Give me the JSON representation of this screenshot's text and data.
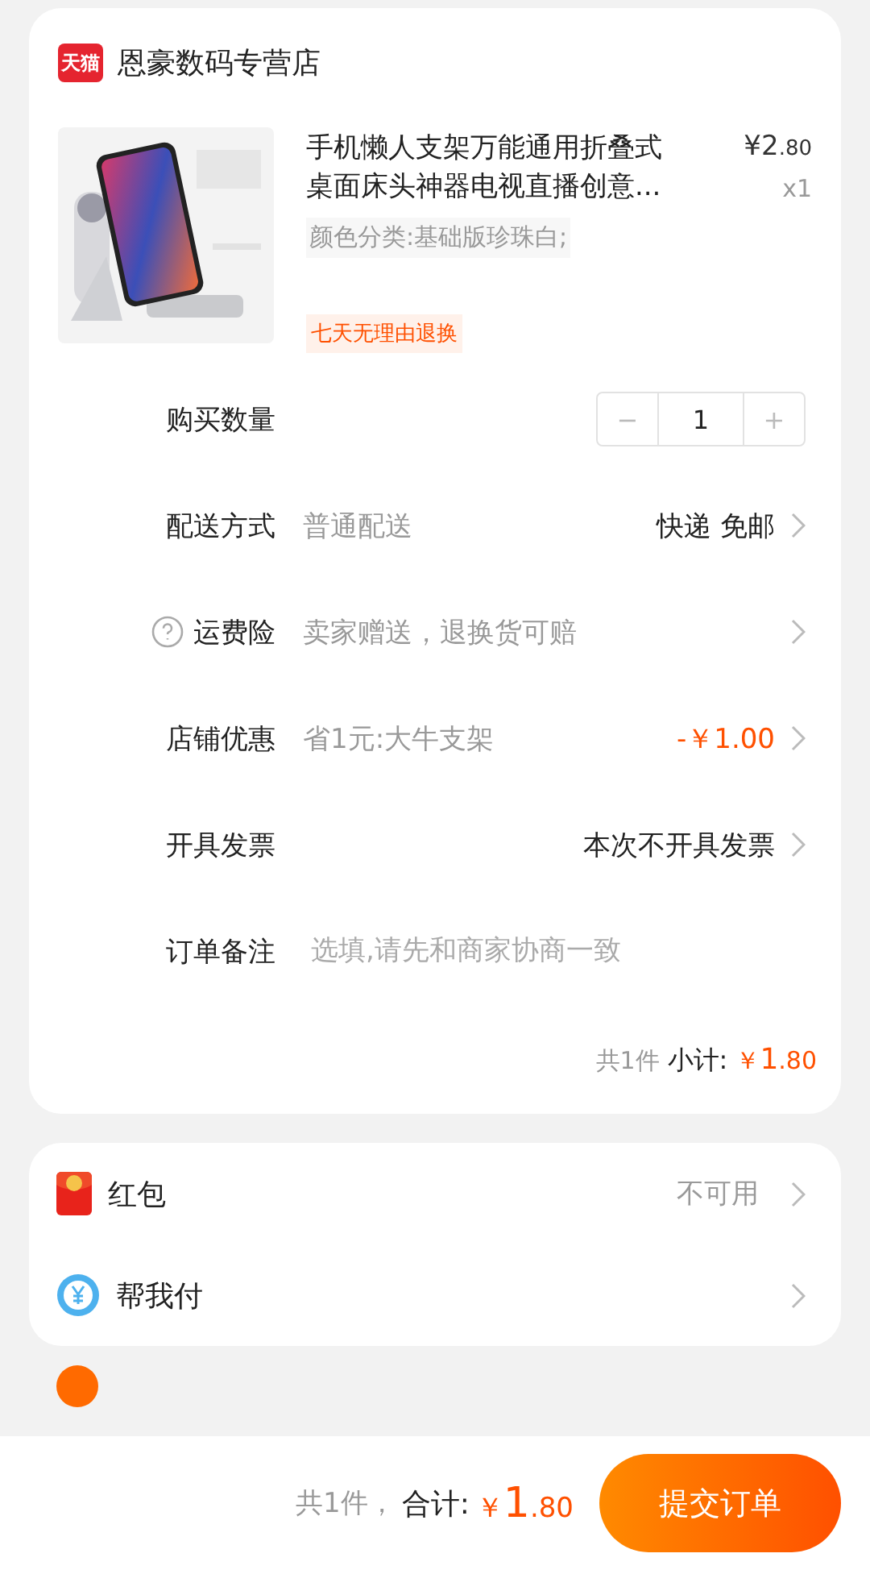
{
  "shop": {
    "badge": "天猫",
    "name": "恩豪数码专营店"
  },
  "product": {
    "title": "手机懒人支架万能通用折叠式桌面床头神器电视直播创意...",
    "price": {
      "main": "¥2",
      "fraction": ".80"
    },
    "quantity": "x1",
    "spec": "颜色分类:基础版珍珠白;",
    "tag": "七天无理由退换"
  },
  "rows": [
    {
      "kind": "stepper",
      "label": "购买数量",
      "minus": "−",
      "value": "1",
      "plus": "+"
    },
    {
      "kind": "option",
      "label": "配送方式",
      "detail": "普通配送",
      "value": "快递 免邮",
      "accent": false
    },
    {
      "kind": "option",
      "label": "运费险",
      "help": true,
      "detail": "卖家赠送，退换货可赔"
    },
    {
      "kind": "option",
      "label": "店铺优惠",
      "detail": "省1元:大牛支架",
      "value": "-￥1.00",
      "accent": true
    },
    {
      "kind": "option",
      "label": "开具发票",
      "value": "本次不开具发票",
      "accent": false
    },
    {
      "kind": "note",
      "label": "订单备注",
      "placeholder": "选填,请先和商家协商一致"
    }
  ],
  "subtotal": {
    "count": "共1件",
    "label": "小计:",
    "currency": "￥",
    "main": "1",
    "fraction": ".80"
  },
  "extras": [
    {
      "kind": "redpacket",
      "label": "红包",
      "value": "不可用"
    },
    {
      "kind": "helppay",
      "label": "帮我付"
    }
  ],
  "footer": {
    "count": "共1件，",
    "label": "合计:",
    "currency": "￥",
    "main": "1",
    "fraction": ".80",
    "button": "提交订单"
  }
}
